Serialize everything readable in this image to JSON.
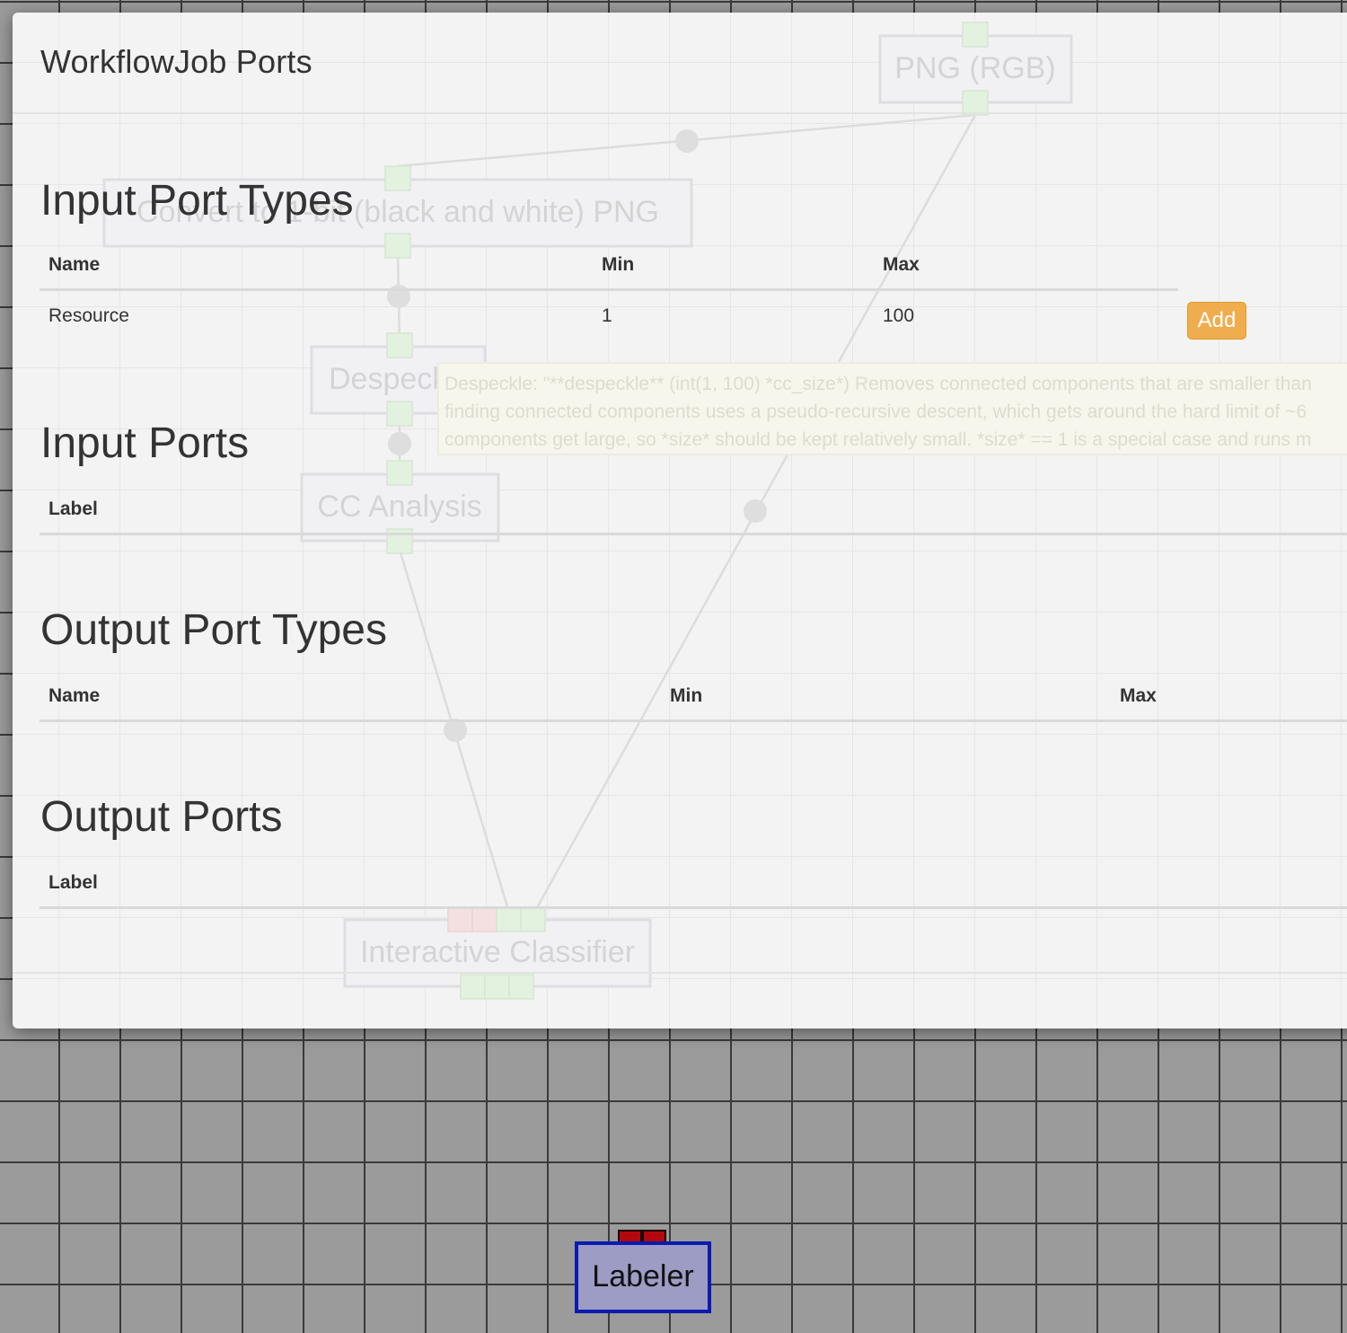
{
  "modal": {
    "title": "WorkflowJob Ports",
    "sections": {
      "input_port_types": {
        "heading": "Input Port Types",
        "columns": [
          "Name",
          "Min",
          "Max"
        ],
        "rows": [
          {
            "name": "Resource",
            "min": "1",
            "max": "100"
          }
        ],
        "add_label": "Add"
      },
      "input_ports": {
        "heading": "Input Ports",
        "columns": [
          "Label"
        ]
      },
      "output_port_types": {
        "heading": "Output Port Types",
        "columns": [
          "Name",
          "Min",
          "Max"
        ]
      },
      "output_ports": {
        "heading": "Output Ports",
        "columns": [
          "Label"
        ]
      }
    }
  },
  "background_workflow": {
    "nodes": [
      "PNG (RGB)",
      "Convert to 1-bit (black and white) PNG",
      "Despeckle",
      "CC Analysis",
      "Interactive Classifier"
    ],
    "tooltip": [
      "Despeckle: \"**despeckle** (int(1, 100) *cc_size*) Removes connected components that are smaller than",
      "finding connected components uses a pseudo-recursive descent, which gets around the hard limit of ~6",
      "components get large, so *size* should be kept relatively small. *size* == 1 is a special case and runs m"
    ]
  },
  "canvas": {
    "labeler_node": "Labeler",
    "colors": {
      "labeler_fill": "#9c9cc4",
      "labeler_border": "#0d1ab0",
      "port_red": "#b3080d",
      "add_button": "#f0ad4e",
      "canvas_bg": "#9b9b9b"
    }
  }
}
